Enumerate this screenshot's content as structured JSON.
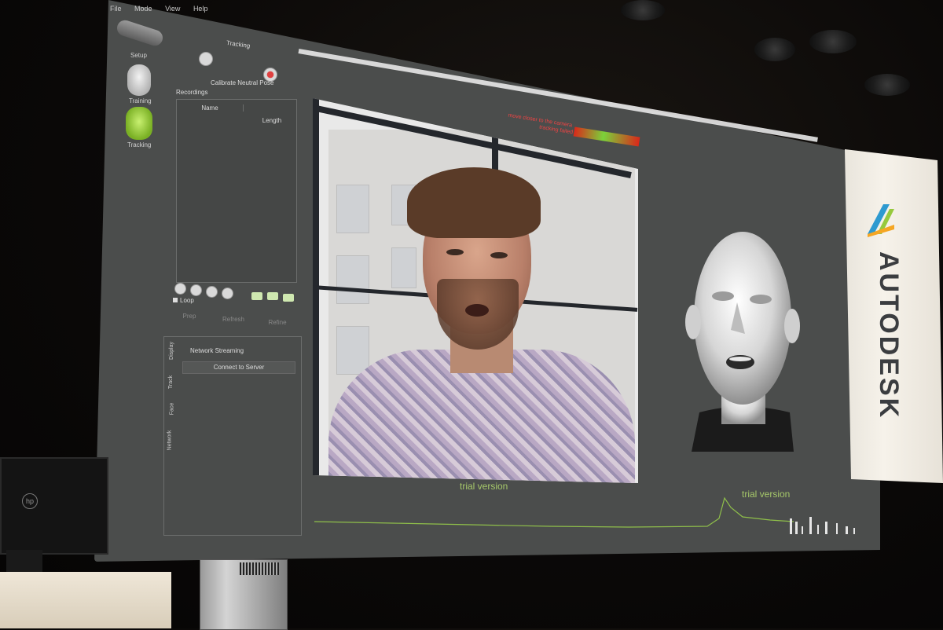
{
  "menubar": {
    "items": [
      "File",
      "Mode",
      "View",
      "Help"
    ]
  },
  "sidebar": {
    "modes": [
      {
        "label": "Setup"
      },
      {
        "label": "Training"
      },
      {
        "label": "Tracking"
      }
    ]
  },
  "tracking_panel": {
    "title": "Tracking",
    "calibrate_label": "Calibrate Neutral Pose",
    "recordings_label": "Recordings",
    "columns": [
      "Name",
      "Length"
    ],
    "loop_label": "Loop",
    "actions": [
      "Prep",
      "Refresh",
      "Refine"
    ]
  },
  "network_panel": {
    "tabs": [
      "Display",
      "Track",
      "Face",
      "Network"
    ],
    "section_title": "Network Streaming",
    "connect_label": "Connect to Server"
  },
  "meter": {
    "hint": "move closer to the camera",
    "status": "tracking failed",
    "colors": [
      "#d9281a",
      "#7bd13a",
      "#d9281a"
    ]
  },
  "overlay": {
    "trial_left": "trial version",
    "trial_right": "trial version"
  },
  "banner": {
    "brand": "AUTODESK",
    "accent": "#2e9ad0"
  },
  "monitor": {
    "logo": "hp"
  }
}
